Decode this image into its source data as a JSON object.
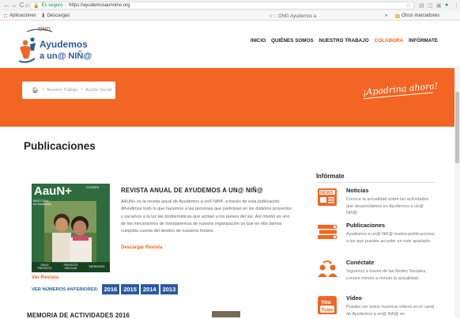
{
  "browser": {
    "secure_label": "Es seguro",
    "url": "https://ayudemosaunnino.org",
    "bookmarks": [
      {
        "label": "Aplicaciones",
        "icon": "apps-grid-icon"
      },
      {
        "label": "Descargas",
        "icon": "download-icon"
      }
    ],
    "bookmark_center": "☆ :: ONG Ayudemos a",
    "bookmark_overflow": "»",
    "bookmark_right": "Otros marcadores"
  },
  "site": {
    "logo_text_top": "ONG",
    "logo_text_1": "Ayudemos",
    "logo_text_2": "a un@ NIÑ@",
    "menu": [
      {
        "label": "INICIO"
      },
      {
        "label": "QUIÉNES SOMOS"
      },
      {
        "label": "NUESTRO TRABAJO"
      },
      {
        "label": "COLABORA"
      },
      {
        "label": "INFÓRMATE"
      }
    ],
    "breadcrumb": [
      "Nuestro Trabajo",
      "Acción Social"
    ],
    "apadrina": "¡Apadrina ahora!"
  },
  "main": {
    "title": "Publicaciones",
    "revista": {
      "title": "REVISTA ANUAL DE AYUDEMOS A UN@ NIÑ@",
      "text": "AAUN+ es la revista anual de Ayudemos a un® Niñ®, a través de esta publicación difundimos todo lo que hacemos a las personas que participan en los distintos proyectos y sacamos a la luz las problemáticas que azotan a los países del sur. Así mismo es uno de los mecanismos de transparencia de nuestra organización ya que en ella damos cumplida cuenta del destino de nuestros fondos.",
      "link": "Descargar Revista",
      "cover": {
        "mast": "AauN+",
        "mast_sub": "DOSSIER",
        "ribbon": "MAYO 2014 · en Guatemala",
        "footer": [
          "GUIAS PROYECTO",
          "PROYECTO ESCOLAR",
          "ENTREVISTA"
        ]
      },
      "ver_revista": "Ver Revista",
      "anteriores_label": "VER NÚMEROS ANTERIORES:",
      "years": [
        "2016",
        "2015",
        "2014",
        "2013"
      ]
    },
    "memoria_title": "MEMORIA DE ACTIVIDADES 2016"
  },
  "sidebar": {
    "title": "Infórmate",
    "items": [
      {
        "title": "Noticias",
        "text": "Conoce la actualidad sobre las actividades que desarrollamos en Ayudemos a un@ Niñ@.",
        "icon": "news-icon"
      },
      {
        "title": "Publicaciones",
        "text": "Ayudemos a un@ Niñ@ realiza publicaciones a las que puedes acceder en este apartado.",
        "icon": "books-icon"
      },
      {
        "title": "Conéctate",
        "text": "Síguenos a través de las Redes Sociales, conoce minuto a minuto la actualidad.",
        "icon": "people-share-icon"
      },
      {
        "title": "Vídeo",
        "text": "Puedes ver todos nuestros vídeos en el canal de Ayudemos a un@ Niñ@ en",
        "icon": "youtube-icon"
      }
    ]
  },
  "colors": {
    "accent": "#f26522",
    "blue": "#2c5aa0"
  }
}
